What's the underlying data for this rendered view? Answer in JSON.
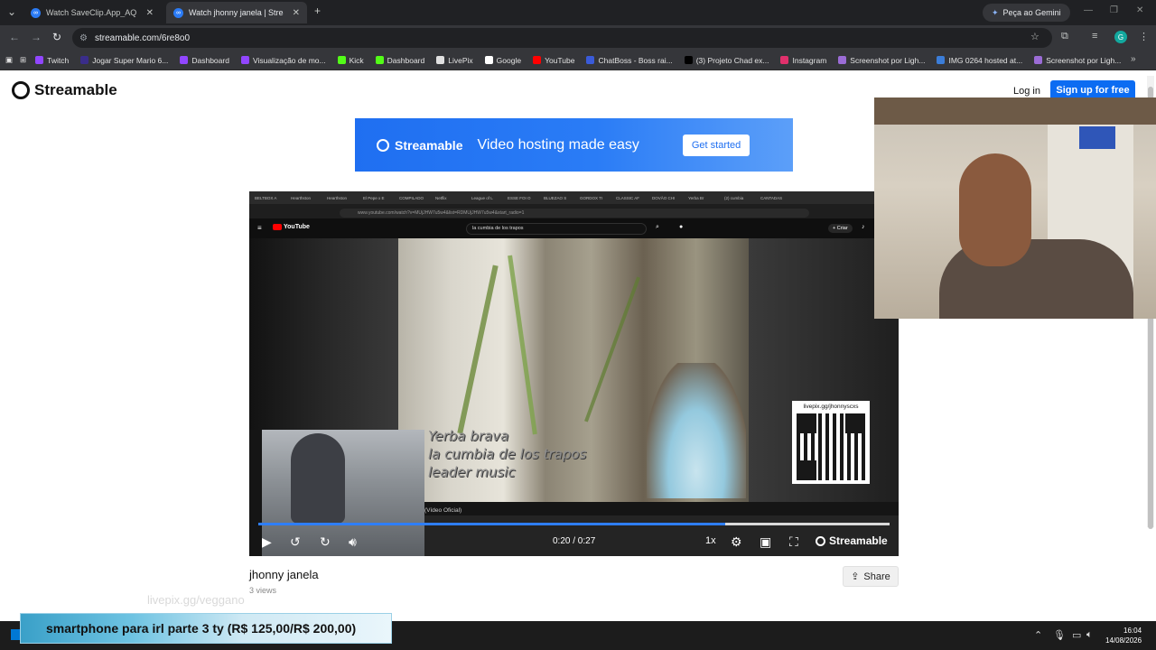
{
  "browser": {
    "tabs": [
      {
        "title": "Watch SaveClip.App_AQMyb3t...",
        "active": false
      },
      {
        "title": "Watch jhonny janela | Streamable",
        "active": true
      }
    ],
    "new_tab_symbol": "+",
    "gemini_label": "Peça ao Gemini",
    "url": "streamable.com/6re8o0",
    "profile_initial": "G",
    "bookmarks": [
      {
        "label": "Twitch",
        "color": "#9146ff"
      },
      {
        "label": "Jogar Super Mario 6...",
        "color": "#3a2d8a"
      },
      {
        "label": "Dashboard",
        "color": "#9146ff"
      },
      {
        "label": "Visualização de mo...",
        "color": "#9146ff"
      },
      {
        "label": "Kick",
        "color": "#53fc18"
      },
      {
        "label": "Dashboard",
        "color": "#53fc18"
      },
      {
        "label": "LivePix",
        "color": "#e0e0e0"
      },
      {
        "label": "Google",
        "color": "#ffffff"
      },
      {
        "label": "YouTube",
        "color": "#ff0000"
      },
      {
        "label": "ChatBoss - Boss rai...",
        "color": "#3a5bd9"
      },
      {
        "label": "(3) Projeto Chad ex...",
        "color": "#000000"
      },
      {
        "label": "Instagram",
        "color": "#e1306c"
      },
      {
        "label": "Screenshot por Ligh...",
        "color": "#9b6cd6"
      },
      {
        "label": "IMG 0264 hosted at...",
        "color": "#3b7dd8"
      },
      {
        "label": "Screenshot por Ligh...",
        "color": "#9b6cd6"
      }
    ]
  },
  "page": {
    "logo_text": "Streamable",
    "login_label": "Log in",
    "signup_label": "Sign up for free",
    "ad": {
      "brand": "Streamable",
      "slogan": "Video hosting made easy",
      "cta": "Get started"
    },
    "video": {
      "title": "jhonny janela",
      "views": "3 views",
      "share_label": "Share",
      "time": "0:20 / 0:27",
      "progress": 0.74,
      "speed": "1x",
      "player_brand": "Streamable"
    },
    "embedded": {
      "yt_tabs": [
        "BELTBOX A",
        "Hearthston",
        "Hearthston",
        "El Pepe x E",
        "COMPILADO",
        "Netflix",
        "League of L",
        "ESSE FOI O",
        "BLUEZAO S",
        "GORDOX TI",
        "CLASSIC AF",
        "DOVÃO CHI",
        "Yerba Br",
        "(2) cumbia",
        "CANTADAS"
      ],
      "yt_url": "www.youtube.com/watch?v=MUjJHW7u5w4&list=RDMUjJHW7u5w4&start_radio=1",
      "yt_logo": "YouTube",
      "yt_search": "la cumbia de los trapos",
      "yt_create": "+ Criar",
      "caption_lines": [
        "Yerba brava",
        "la cumbia de los trapos",
        "leader music"
      ],
      "qr_label": "livepix.gg/jhonnyscxs",
      "oficial": "(Vídeo Oficial)"
    }
  },
  "overlay": {
    "livepix_watermark": "livepix.gg/veggano",
    "donation_text": "smartphone para irl parte 3 ty (R$ 125,00/R$ 200,00)"
  },
  "taskbar": {
    "time": "16:04",
    "date": "14/08/2026"
  }
}
